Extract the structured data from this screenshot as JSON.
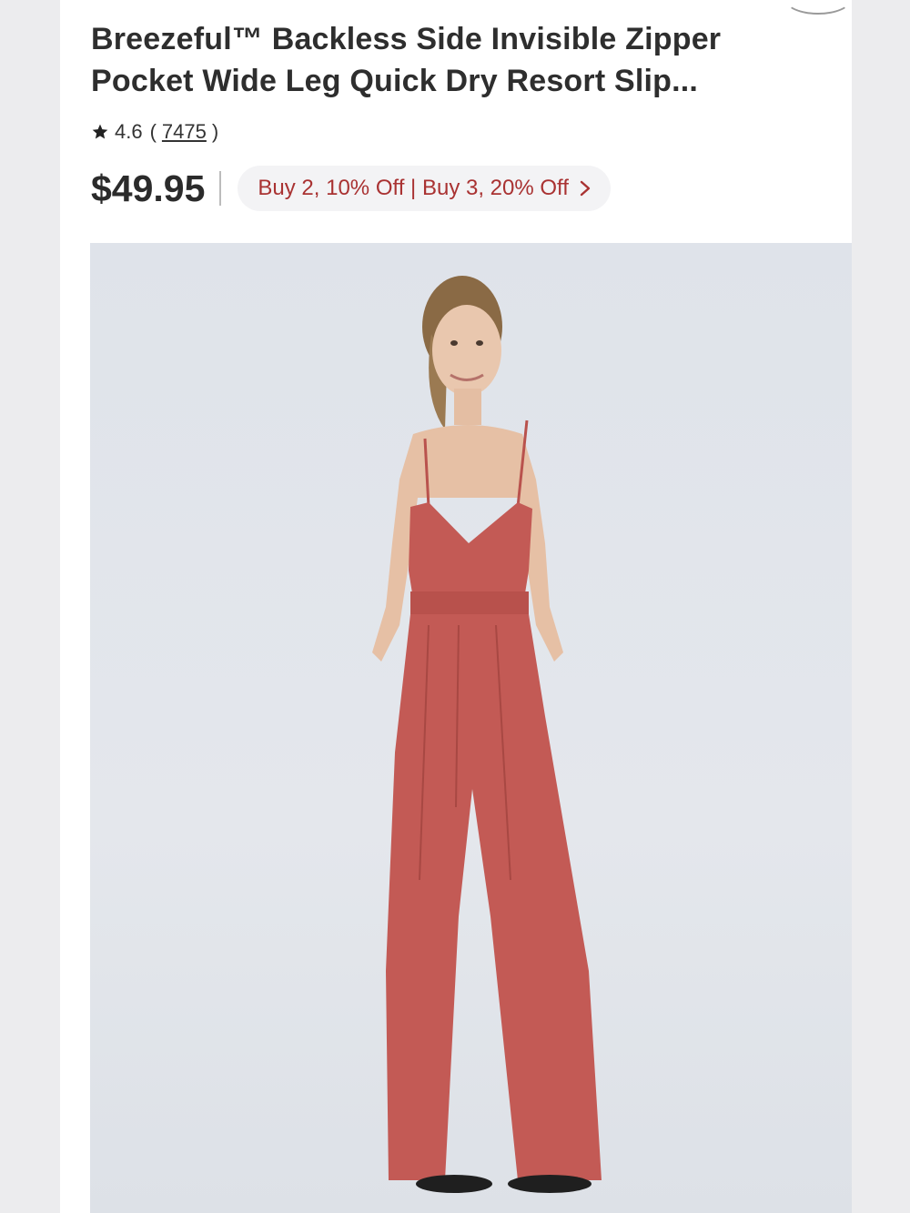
{
  "product": {
    "title": "Breezeful™ Backless Side Invisible Zipper Pocket Wide Leg Quick Dry Resort Slip...",
    "rating": "4.6",
    "rating_open": "(",
    "review_count": "7475",
    "rating_close": ")",
    "price": "$49.95",
    "promo_text": "Buy 2, 10% Off | Buy 3, 20% Off",
    "icons": {
      "star": "star-icon",
      "promo_arrow": "chevron-right-icon"
    },
    "colors": {
      "promo_text": "#a93232",
      "garment": "#c35a55"
    }
  }
}
